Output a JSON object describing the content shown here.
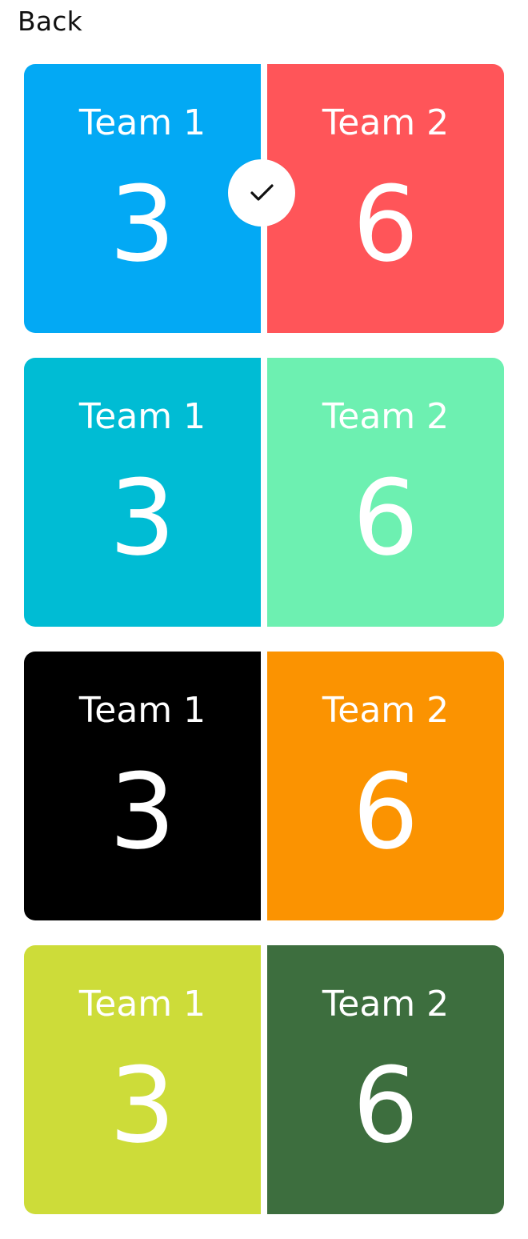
{
  "nav": {
    "back_label": "Back"
  },
  "themes": [
    {
      "team1": {
        "label": "Team 1",
        "score": "3",
        "color": "#03A9F4"
      },
      "team2": {
        "label": "Team 2",
        "score": "6",
        "color": "#FF5559"
      },
      "selected": true
    },
    {
      "team1": {
        "label": "Team 1",
        "score": "3",
        "color": "#00BCD4"
      },
      "team2": {
        "label": "Team 2",
        "score": "6",
        "color": "#6DF0B1"
      },
      "selected": false
    },
    {
      "team1": {
        "label": "Team 1",
        "score": "3",
        "color": "#000000"
      },
      "team2": {
        "label": "Team 2",
        "score": "6",
        "color": "#FB9301"
      },
      "selected": false
    },
    {
      "team1": {
        "label": "Team 1",
        "score": "3",
        "color": "#CDDC39"
      },
      "team2": {
        "label": "Team 2",
        "score": "6",
        "color": "#3D6E3E"
      },
      "selected": false
    }
  ],
  "icons": {
    "selected": "check-icon"
  }
}
